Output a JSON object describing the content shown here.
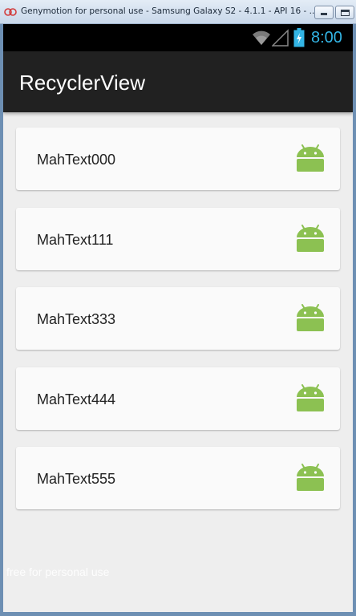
{
  "window": {
    "title": "Genymotion for personal use - Samsung Galaxy S2 - 4.1.1 - API 16 - ..."
  },
  "statusbar": {
    "time": "8:00",
    "icons": [
      "wifi-icon",
      "signal-icon",
      "battery-charging-icon"
    ],
    "accent_color": "#33b5e5"
  },
  "actionbar": {
    "title": "RecyclerView",
    "background": "#212121"
  },
  "list": {
    "items": [
      {
        "label": "MahText000",
        "icon": "android-icon"
      },
      {
        "label": "MahText111",
        "icon": "android-icon"
      },
      {
        "label": "MahText333",
        "icon": "android-icon"
      },
      {
        "label": "MahText444",
        "icon": "android-icon"
      },
      {
        "label": "MahText555",
        "icon": "android-icon"
      }
    ]
  },
  "watermark": "free for personal use",
  "colors": {
    "android_green": "#8cc152",
    "card_background": "#fafafa",
    "screen_background": "#eeeeee"
  }
}
